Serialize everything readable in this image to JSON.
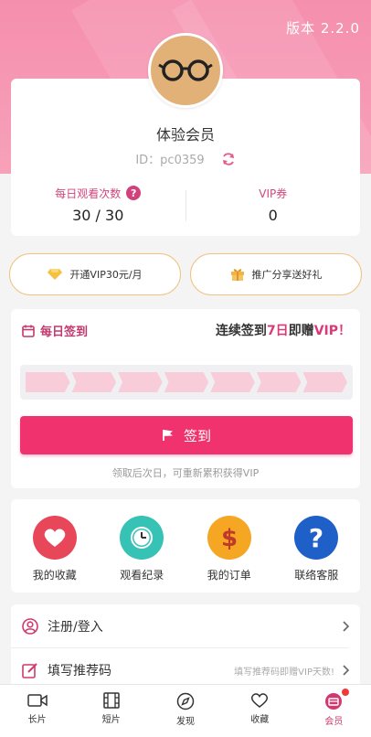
{
  "app": {
    "version_text": "版本 2.2.0"
  },
  "profile": {
    "username": "体验会员",
    "user_id": "ID：pc0359",
    "daily_watch_label": "每日观看次数",
    "daily_watch_value": "30 / 30",
    "vip_coupon_label": "VIP券",
    "vip_coupon_value": "0"
  },
  "actions": {
    "open_vip": "开通VIP30元/月",
    "share_gift": "推广分享送好礼"
  },
  "signin": {
    "title": "每日签到",
    "promo_prefix": "连续签到",
    "promo_days": "7日",
    "promo_mid": "即赠",
    "promo_vip": "VIP！",
    "progress_filled_days": 7,
    "progress_total_days": 7,
    "button_label": "签到",
    "note": "领取后次日，可重新累积获得VIP"
  },
  "quick_links": [
    {
      "label": "我的收藏",
      "icon": "heart-icon",
      "color": "#e8475a"
    },
    {
      "label": "观看纪录",
      "icon": "clock-icon",
      "color": "#36c2b4"
    },
    {
      "label": "我的订单",
      "icon": "dollar-icon",
      "color": "#f5a623"
    },
    {
      "label": "联络客服",
      "icon": "question-icon",
      "color": "#1f5fc8"
    }
  ],
  "menu": [
    {
      "label": "注册/登入",
      "hint": ""
    },
    {
      "label": "填写推荐码",
      "hint": "填写推荐码即赠VIP天数!"
    }
  ],
  "tabbar": [
    {
      "label": "长片",
      "icon": "video-camera-icon"
    },
    {
      "label": "短片",
      "icon": "film-icon"
    },
    {
      "label": "发现",
      "icon": "compass-icon"
    },
    {
      "label": "收藏",
      "icon": "heart-outline-icon"
    },
    {
      "label": "会员",
      "icon": "member-icon",
      "active": true
    }
  ],
  "colors": {
    "brand_pink": "#f0336e",
    "hero_pink": "#f58fae",
    "accent_gold": "#f0c27f"
  }
}
